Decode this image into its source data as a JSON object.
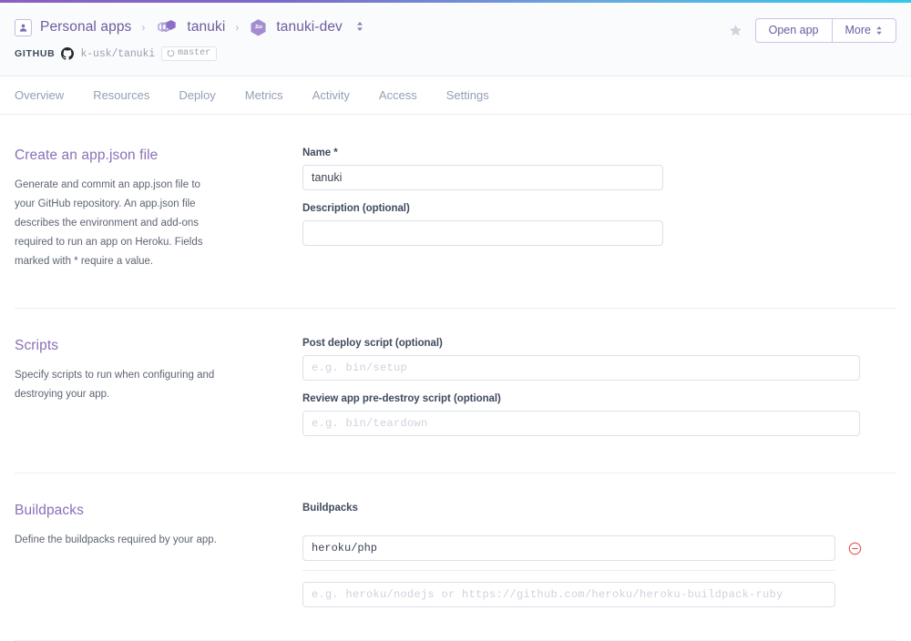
{
  "header": {
    "breadcrumb": [
      {
        "label": "Personal apps",
        "icon": "person-icon"
      },
      {
        "label": "tanuki",
        "icon": "pipeline-hexagons-icon"
      },
      {
        "label": "tanuki-dev",
        "icon": "sleeping-app-hexagon-icon",
        "has_chevron": true
      }
    ],
    "separator": "›",
    "chevron": "⌃⌄",
    "star_icon": "star-icon",
    "open_app_label": "Open app",
    "more_label": "More",
    "more_chevron": "⌃⌄",
    "github": {
      "provider_label": "GITHUB",
      "provider_icon": "github-icon",
      "repo": "k-usk/tanuki",
      "branch_icon": "sync-icon",
      "branch": "master"
    }
  },
  "nav": {
    "tabs": [
      {
        "label": "Overview"
      },
      {
        "label": "Resources"
      },
      {
        "label": "Deploy"
      },
      {
        "label": "Metrics"
      },
      {
        "label": "Activity"
      },
      {
        "label": "Access"
      },
      {
        "label": "Settings"
      }
    ]
  },
  "sections": {
    "appjson": {
      "title": "Create an app.json file",
      "description": "Generate and commit an app.json file to your GitHub repository. An app.json file describes the environment and add-ons required to run an app on Heroku. Fields marked with * require a value.",
      "name_label": "Name *",
      "name_value": "tanuki",
      "description_label": "Description (optional)",
      "description_value": ""
    },
    "scripts": {
      "title": "Scripts",
      "description": "Specify scripts to run when configuring and destroying your app.",
      "post_deploy_label": "Post deploy script (optional)",
      "post_deploy_placeholder": "e.g. bin/setup",
      "post_deploy_value": "",
      "pre_destroy_label": "Review app pre-destroy script (optional)",
      "pre_destroy_placeholder": "e.g. bin/teardown",
      "pre_destroy_value": ""
    },
    "buildpacks": {
      "title": "Buildpacks",
      "description": "Define the buildpacks required by your app.",
      "field_label": "Buildpacks",
      "entry_value": "heroku/php",
      "remove_icon": "remove-circle-icon",
      "new_placeholder": "e.g. heroku/nodejs or https://github.com/heroku/heroku-buildpack-ruby",
      "new_value": ""
    }
  },
  "colors": {
    "accent_purple": "#6e5ca0",
    "section_title": "#8b6fb8",
    "label": "#3f4b5e",
    "tab": "#93a0b5",
    "border": "#dbe0e8",
    "danger": "#e8535a"
  }
}
